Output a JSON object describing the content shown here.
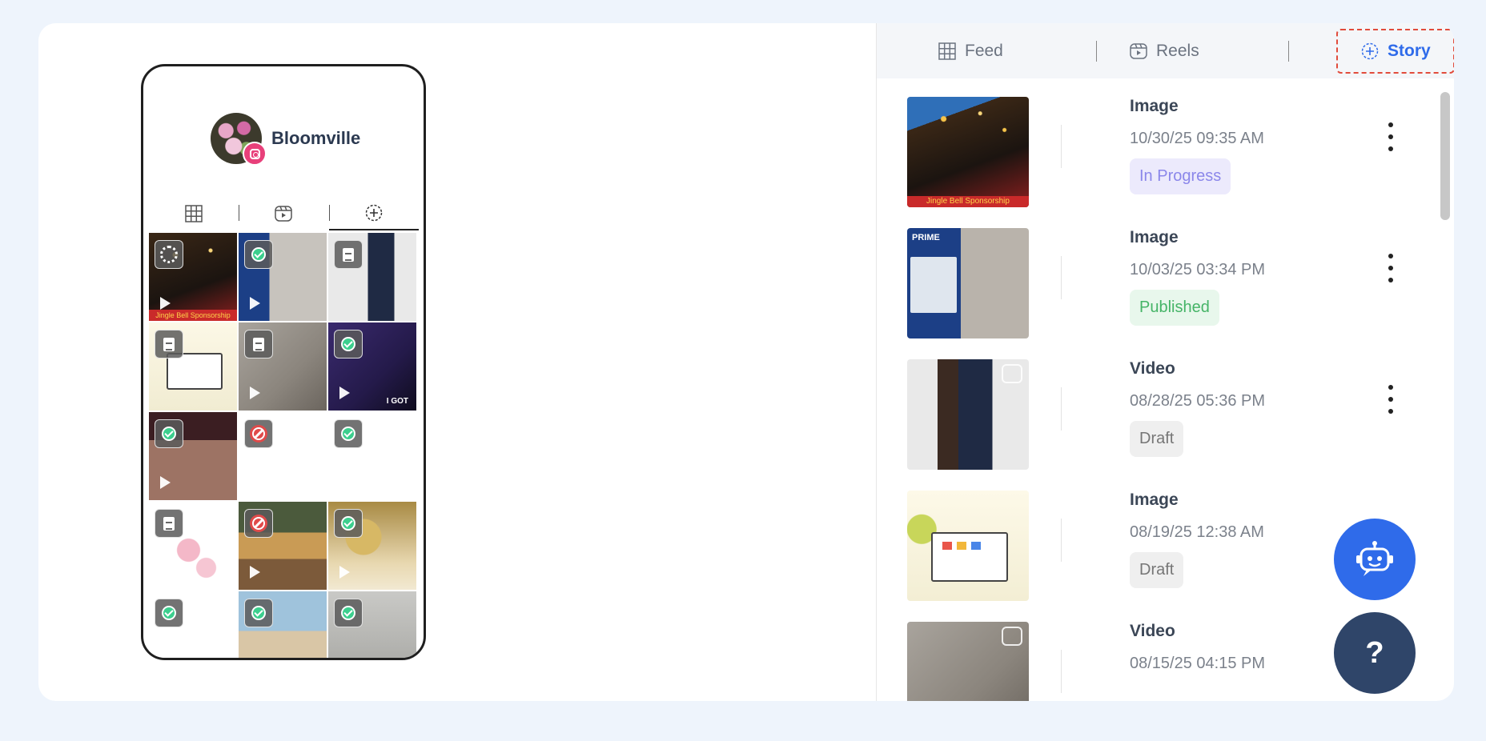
{
  "phone": {
    "profile_name": "Bloomville",
    "tabs": [
      "grid-icon",
      "reels-icon",
      "story-add-icon"
    ],
    "grid": [
      {
        "status": "loading",
        "play": true,
        "caption": "Jingle Bell Sponsorship"
      },
      {
        "status": "published",
        "play": true
      },
      {
        "status": "draft",
        "play": true
      },
      {
        "status": "draft",
        "play": false
      },
      {
        "status": "draft",
        "play": true
      },
      {
        "status": "published",
        "play": true,
        "caption": "I GOT"
      },
      {
        "status": "published",
        "play": true
      },
      {
        "status": "rejected",
        "play": false
      },
      {
        "status": "published",
        "play": false
      },
      {
        "status": "draft",
        "play": false
      },
      {
        "status": "rejected",
        "play": true
      },
      {
        "status": "published",
        "play": true
      },
      {
        "status": "published",
        "play": false
      },
      {
        "status": "published",
        "play": false
      },
      {
        "status": "published",
        "play": false
      }
    ]
  },
  "tabs": {
    "feed": "Feed",
    "reels": "Reels",
    "story": "Story"
  },
  "posts": [
    {
      "type": "Image",
      "date": "10/30/25 09:35 AM",
      "status": "In Progress",
      "thumb_caption": "Jingle Bell Sponsorship"
    },
    {
      "type": "Image",
      "date": "10/03/25 03:34 PM",
      "status": "Published",
      "thumb_caption": "PRIME"
    },
    {
      "type": "Video",
      "date": "08/28/25 05:36 PM",
      "status": "Draft"
    },
    {
      "type": "Image",
      "date": "08/19/25 12:38 AM",
      "status": "Draft"
    },
    {
      "type": "Video",
      "date": "08/15/25 04:15 PM",
      "status": ""
    }
  ],
  "fab": {
    "help": "?"
  },
  "colors": {
    "accent": "#2f6bea",
    "active_tab_border": "#e14b3b",
    "in_progress": "#8b87ea",
    "published": "#45b467",
    "draft": "#767676"
  }
}
